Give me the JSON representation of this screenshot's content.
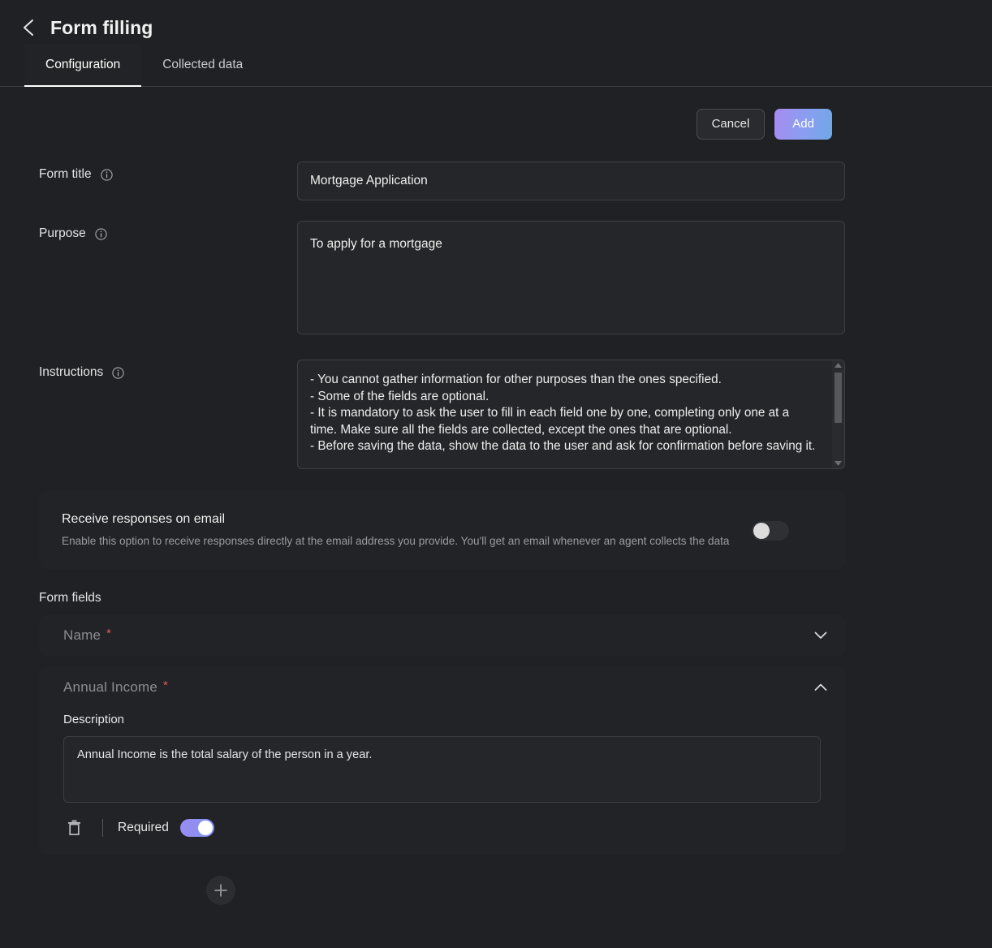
{
  "header": {
    "back_icon": "chevron-left-icon",
    "title": "Form filling"
  },
  "tabs": [
    {
      "label": "Configuration",
      "active": true
    },
    {
      "label": "Collected data",
      "active": false
    }
  ],
  "actions": {
    "cancel_label": "Cancel",
    "add_label": "Add",
    "add_gradient_from": "#a78bf0",
    "add_gradient_to": "#6fa8e8"
  },
  "fields": {
    "form_title": {
      "label": "Form title",
      "info_icon": "info-circle-icon",
      "value": "Mortgage Application"
    },
    "purpose": {
      "label": "Purpose",
      "info_icon": "info-circle-icon",
      "value": "To apply for a mortgage"
    },
    "instructions": {
      "label": "Instructions",
      "info_icon": "info-circle-icon",
      "value": "- You cannot gather information for other purposes than the ones specified.\n- Some of the fields are optional.\n- It is mandatory to ask the user to fill in each field one by one, completing only one at a time. Make sure all the fields are collected, except the ones that are optional.\n- Before saving the data, show the data to the user and ask for confirmation before saving it."
    }
  },
  "email_card": {
    "title": "Receive responses on email",
    "description": "Enable this option to receive responses directly at the email address you provide. You'll get an email whenever an agent collects the data",
    "toggle_state": "off"
  },
  "form_fields": {
    "section_label": "Form fields",
    "items": [
      {
        "name": "Name",
        "required_marker": "*",
        "expanded": false,
        "chevron_icon": "chevron-down-icon"
      },
      {
        "name": "Annual Income",
        "required_marker": "*",
        "expanded": true,
        "chevron_icon": "chevron-up-icon",
        "description_label": "Description",
        "description_value": "Annual Income is the total salary of the person in a year.",
        "delete_icon": "trash-icon",
        "required_label": "Required",
        "required_toggle_state": "on"
      }
    ],
    "add_field_icon": "plus-icon"
  },
  "colors": {
    "page_bg": "#202124",
    "card_bg": "#222326",
    "input_bg": "#25262a",
    "required_star": "#e25c54",
    "accent_start": "#9b8cf2",
    "accent_end": "#7f93ef"
  }
}
